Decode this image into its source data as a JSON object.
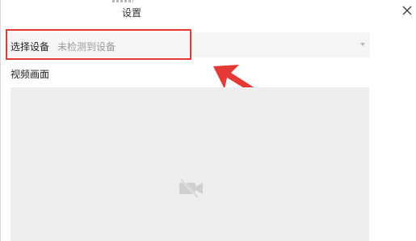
{
  "window": {
    "title": "设置"
  },
  "device": {
    "label": "选择设备",
    "selected_value": "未检测到设备"
  },
  "video": {
    "label": "视频画面"
  },
  "icons": {
    "close": "close-icon",
    "dropdown": "caret-down-icon",
    "camera_off": "camera-off-icon",
    "annotation": "annotation-arrow"
  },
  "colors": {
    "annotation_red": "#e53935",
    "select_bg": "#f5f5f5",
    "preview_bg": "#eeeeee",
    "placeholder_text": "#9a9a9a"
  }
}
